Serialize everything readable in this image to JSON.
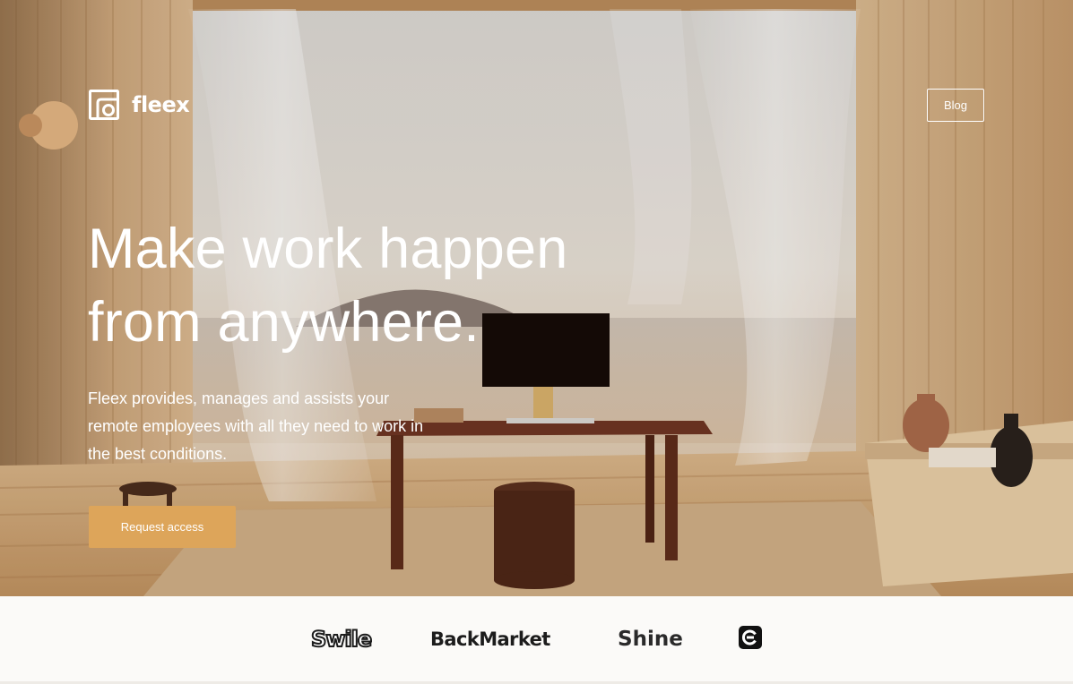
{
  "brand": {
    "name": "fleex"
  },
  "nav": {
    "blog_label": "Blog"
  },
  "hero": {
    "headline_line1": "Make work happen",
    "headline_line2": "from anywhere.",
    "subtitle": "Fleex provides, manages and assists your remote employees with all they need to work in the best conditions.",
    "cta_label": "Request access"
  },
  "clients": {
    "items": [
      "Swile",
      "BackMarket",
      "Shine"
    ],
    "badge_icon": "e-badge-icon"
  },
  "colors": {
    "accent": "#dda55a",
    "text_on_hero": "#ffffff",
    "logo_strip_bg": "#fbfaf8"
  }
}
